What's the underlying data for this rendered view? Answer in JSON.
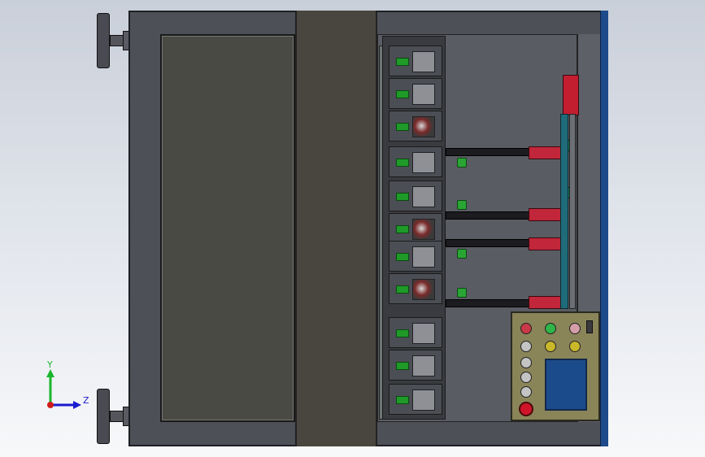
{
  "axes_triad": {
    "y_label": "Y",
    "z_label": "Z",
    "colors": {
      "y": "#1bb52c",
      "z": "#1b1bd0",
      "x": "#d01b1b"
    }
  },
  "colors": {
    "background_top": "#c9cfd9",
    "frame": "#4e5058",
    "accent_blue": "#1d4a8a",
    "cylinder_red": "#c1263a",
    "sensor_green": "#1f9a28",
    "control_box": "#8a8459"
  },
  "control_panel": {
    "buttons": [
      {
        "color": "red",
        "icon": "button-icon"
      },
      {
        "color": "green",
        "icon": "button-icon"
      },
      {
        "color": "pink",
        "icon": "button-icon"
      },
      {
        "color": "white",
        "icon": "button-icon"
      },
      {
        "color": "yellow",
        "icon": "button-icon"
      },
      {
        "color": "yellow",
        "icon": "button-icon"
      },
      {
        "color": "white",
        "icon": "button-icon"
      },
      {
        "color": "white",
        "icon": "button-icon"
      },
      {
        "color": "white",
        "icon": "button-icon"
      }
    ],
    "emergency_stop": {
      "color": "red",
      "icon": "emergency-stop-icon"
    },
    "screen_icon": "hmi-screen-icon"
  },
  "handles": [
    {
      "icon": "handwheel-icon"
    },
    {
      "icon": "handwheel-icon"
    }
  ]
}
